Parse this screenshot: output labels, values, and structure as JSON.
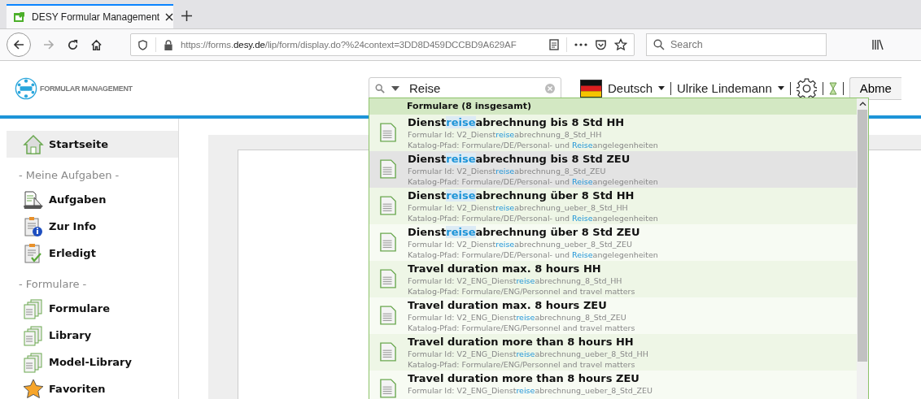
{
  "browser": {
    "tab_title": "DESY Formular Management",
    "url": {
      "prefix": "https://forms.",
      "domain": "desy.de",
      "rest": "/lip/form/display.do?%24context=3DD8D459DCCBD9A629AF"
    },
    "search_placeholder": "Search"
  },
  "header": {
    "logo_text": "FORMULAR MANAGEMENT",
    "search_value": "Reise",
    "language": "Deutsch",
    "user": "Ulrike Lindemann",
    "logout": "Abme"
  },
  "dropdown": {
    "heading": "Formulare (8 insgesamt)",
    "results": [
      {
        "title": [
          {
            "text": "Dienst",
            "match": false
          },
          {
            "text": "reise",
            "match": true
          },
          {
            "text": "abrechnung bis 8 Std HH",
            "match": false
          }
        ],
        "id_label": "Formular Id:",
        "id": [
          {
            "text": "V2_Dienst",
            "match": false
          },
          {
            "text": "reise",
            "match": true
          },
          {
            "text": "abrechnung_8_Std_HH",
            "match": false
          }
        ],
        "path_label": "Katalog-Pfad:",
        "path": [
          {
            "text": "Formulare/DE/Personal- und ",
            "match": false
          },
          {
            "text": "Reise",
            "match": true
          },
          {
            "text": "angelegenheiten",
            "match": false
          }
        ],
        "selected": false
      },
      {
        "title": [
          {
            "text": "Dienst",
            "match": false
          },
          {
            "text": "reise",
            "match": true
          },
          {
            "text": "abrechnung bis 8 Std ZEU",
            "match": false
          }
        ],
        "id_label": "Formular Id:",
        "id": [
          {
            "text": "V2_Dienst",
            "match": false
          },
          {
            "text": "reise",
            "match": true
          },
          {
            "text": "abrechnung_8_Std_ZEU",
            "match": false
          }
        ],
        "path_label": "Katalog-Pfad:",
        "path": [
          {
            "text": "Formulare/DE/Personal- und ",
            "match": false
          },
          {
            "text": "Reise",
            "match": true
          },
          {
            "text": "angelegenheiten",
            "match": false
          }
        ],
        "selected": true
      },
      {
        "title": [
          {
            "text": "Dienst",
            "match": false
          },
          {
            "text": "reise",
            "match": true
          },
          {
            "text": "abrechnung über 8 Std HH",
            "match": false
          }
        ],
        "id_label": "Formular Id:",
        "id": [
          {
            "text": "V2_Dienst",
            "match": false
          },
          {
            "text": "reise",
            "match": true
          },
          {
            "text": "abrechnung_ueber_8_Std_HH",
            "match": false
          }
        ],
        "path_label": "Katalog-Pfad:",
        "path": [
          {
            "text": "Formulare/DE/Personal- und ",
            "match": false
          },
          {
            "text": "Reise",
            "match": true
          },
          {
            "text": "angelegenheiten",
            "match": false
          }
        ],
        "selected": false
      },
      {
        "title": [
          {
            "text": "Dienst",
            "match": false
          },
          {
            "text": "reise",
            "match": true
          },
          {
            "text": "abrechnung über 8 Std ZEU",
            "match": false
          }
        ],
        "id_label": "Formular Id:",
        "id": [
          {
            "text": "V2_Dienst",
            "match": false
          },
          {
            "text": "reise",
            "match": true
          },
          {
            "text": "abrechnung_ueber_8_Std_ZEU",
            "match": false
          }
        ],
        "path_label": "Katalog-Pfad:",
        "path": [
          {
            "text": "Formulare/DE/Personal- und ",
            "match": false
          },
          {
            "text": "Reise",
            "match": true
          },
          {
            "text": "angelegenheiten",
            "match": false
          }
        ],
        "selected": false
      },
      {
        "title": [
          {
            "text": "Travel duration max. 8 hours HH",
            "match": false
          }
        ],
        "id_label": "Formular Id:",
        "id": [
          {
            "text": "V2_ENG_Dienst",
            "match": false
          },
          {
            "text": "reise",
            "match": true
          },
          {
            "text": "abrechnung_8_Std_HH",
            "match": false
          }
        ],
        "path_label": "Katalog-Pfad:",
        "path": [
          {
            "text": "Formulare/ENG/Personnel and travel matters",
            "match": false
          }
        ],
        "selected": false
      },
      {
        "title": [
          {
            "text": "Travel duration max. 8 hours ZEU",
            "match": false
          }
        ],
        "id_label": "Formular Id:",
        "id": [
          {
            "text": "V2_ENG_Dienst",
            "match": false
          },
          {
            "text": "reise",
            "match": true
          },
          {
            "text": "abrechnung_8_Std_ZEU",
            "match": false
          }
        ],
        "path_label": "Katalog-Pfad:",
        "path": [
          {
            "text": "Formulare/ENG/Personnel and travel matters",
            "match": false
          }
        ],
        "selected": false
      },
      {
        "title": [
          {
            "text": "Travel duration more than 8 hours HH",
            "match": false
          }
        ],
        "id_label": "Formular Id:",
        "id": [
          {
            "text": "V2_ENG_Dienst",
            "match": false
          },
          {
            "text": "reise",
            "match": true
          },
          {
            "text": "abrechnung_ueber_8_Std_HH",
            "match": false
          }
        ],
        "path_label": "Katalog-Pfad:",
        "path": [
          {
            "text": "Formulare/ENG/Personnel and travel matters",
            "match": false
          }
        ],
        "selected": false
      },
      {
        "title": [
          {
            "text": "Travel duration more than 8 hours ZEU",
            "match": false
          }
        ],
        "id_label": "Formular Id:",
        "id": [
          {
            "text": "V2_ENG_Dienst",
            "match": false
          },
          {
            "text": "reise",
            "match": true
          },
          {
            "text": "abrechnung_ueber_8_Std_ZEU",
            "match": false
          }
        ],
        "selected": false
      }
    ]
  },
  "sidebar": {
    "items": [
      {
        "kind": "link",
        "label": "Startseite",
        "selected": true
      },
      {
        "kind": "section",
        "label": "- Meine Aufgaben -"
      },
      {
        "kind": "link",
        "label": "Aufgaben",
        "selected": false
      },
      {
        "kind": "link",
        "label": "Zur Info",
        "selected": false
      },
      {
        "kind": "link",
        "label": "Erledigt",
        "selected": false
      },
      {
        "kind": "section",
        "label": "- Formulare -"
      },
      {
        "kind": "link",
        "label": "Formulare",
        "selected": false
      },
      {
        "kind": "link",
        "label": "Library",
        "selected": false
      },
      {
        "kind": "link",
        "label": "Model-Library",
        "selected": false
      },
      {
        "kind": "link",
        "label": "Favoriten",
        "selected": false
      }
    ]
  }
}
